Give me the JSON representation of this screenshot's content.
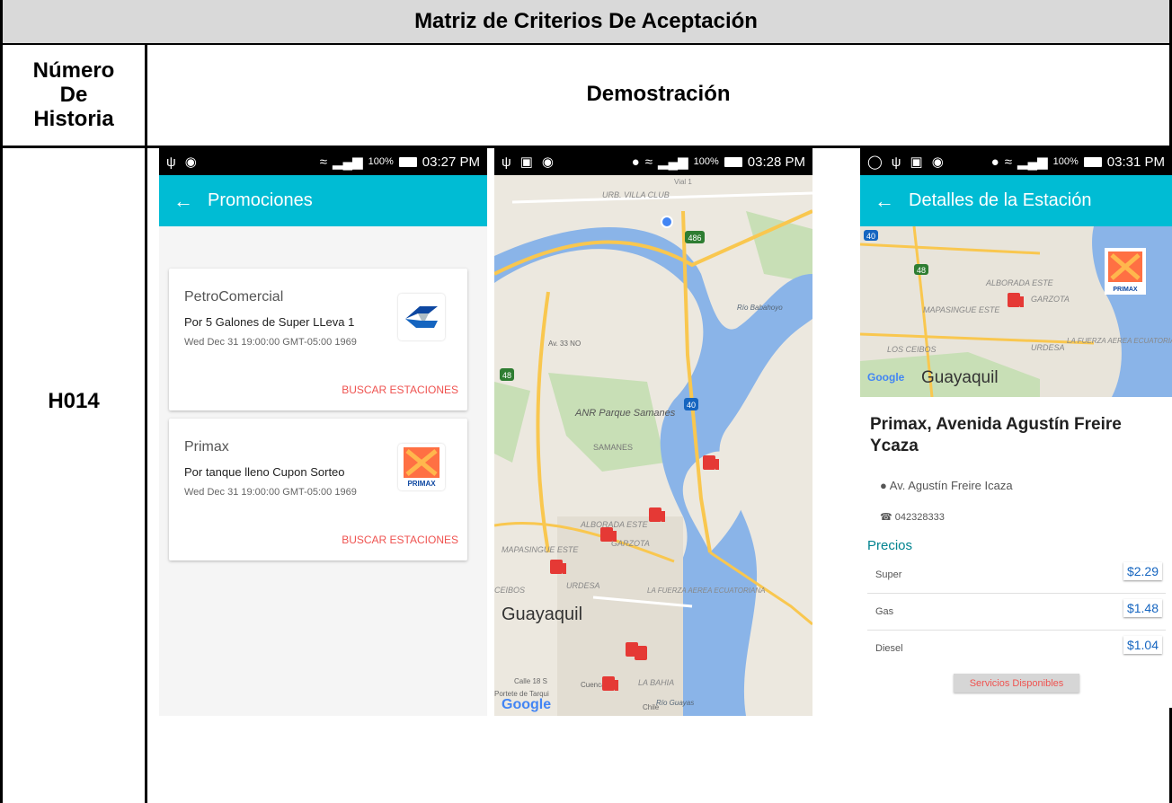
{
  "table": {
    "title": "Matriz de Criterios De Aceptación",
    "col1_header": "Número\nDe\nHistoria",
    "col2_header": "Demostración",
    "story_id": "H014"
  },
  "screen1": {
    "status_time": "03:27 PM",
    "battery": "100%",
    "appbar_title": "Promociones",
    "promotions": [
      {
        "brand": "PetroComercial",
        "description": "Por 5 Galones de Super LLeva 1",
        "date": "Wed Dec 31 19:00:00 GMT-05:00 1969",
        "cta": "BUSCAR ESTACIONES"
      },
      {
        "brand": "Primax",
        "description": "Por tanque lleno Cupon Sorteo",
        "date": "Wed Dec 31 19:00:00 GMT-05:00 1969",
        "cta": "BUSCAR ESTACIONES"
      }
    ],
    "logo_text": "PRIMAX"
  },
  "screen2": {
    "status_time": "03:28 PM",
    "battery": "100%",
    "map_labels": {
      "urb_villa_club": "URB. VILLA CLUB",
      "vial1": "Vial 1",
      "road486": "486",
      "road48": "48",
      "road40": "40",
      "parque": "ANR Parque Samanes",
      "samanes": "SAMANES",
      "alborada": "ALBORADA ESTE",
      "garzota": "GARZOTA",
      "mapasingue": "MAPASINGUE ESTE",
      "urdesa": "URDESA",
      "fuerza": "LA FUERZA AEREA ECUATORIANA",
      "ceibos": "CEIBOS",
      "city": "Guayaquil",
      "calle18": "Calle 18 S",
      "portete": "Portete de Tarqui",
      "cuenca": "Cuenca",
      "bahia": "LA BAHIA",
      "chile": "Chile",
      "rio_guayas": "Río Guayas",
      "rio_babahoyo": "Río Babahoyo",
      "av33": "Av. 33 NO",
      "google": "Google"
    }
  },
  "screen3": {
    "status_time": "03:31 PM",
    "battery": "100%",
    "appbar_title": "Detalles de la Estación",
    "map_labels": {
      "road40": "40",
      "road48": "48",
      "alborada": "ALBORADA ESTE",
      "garzota": "GARZOTA",
      "mapasingue": "MAPASINGUE ESTE",
      "ceibos": "LOS CEIBOS",
      "urdesa": "URDESA",
      "fuerza": "LA FUERZA AEREA ECUATORIANA",
      "city": "Guayaquil",
      "google": "Google"
    },
    "logo_text": "PRIMAX",
    "station_name": "Primax, Avenida Agustín Freire Ycaza",
    "address": "Av. Agustín Freire Icaza",
    "phone": "042328333",
    "prices_header": "Precios",
    "prices": [
      {
        "fuel": "Super",
        "price": "$2.29"
      },
      {
        "fuel": "Gas",
        "price": "$1.48"
      },
      {
        "fuel": "Diesel",
        "price": "$1.04"
      }
    ],
    "services_button": "Servicios Disponibles"
  },
  "colors": {
    "appbar": "#00bcd4",
    "accent_red": "#ef5350",
    "price_blue": "#1565c0",
    "header_gray": "#d9d9d9",
    "water": "#8ab4e8",
    "pin_red": "#e53935"
  }
}
